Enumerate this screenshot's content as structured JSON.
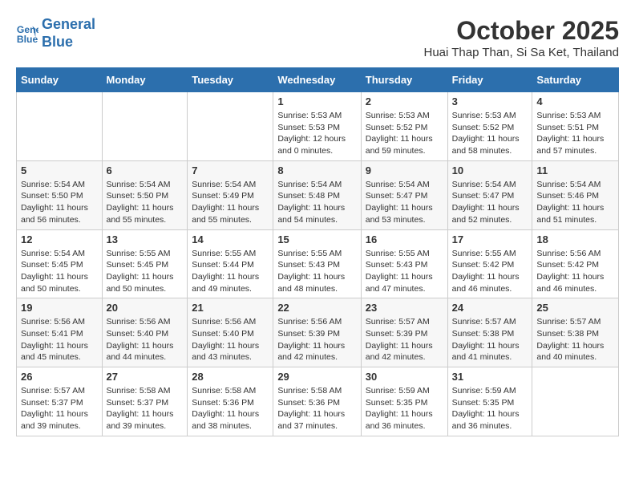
{
  "header": {
    "logo_line1": "General",
    "logo_line2": "Blue",
    "month": "October 2025",
    "location": "Huai Thap Than, Si Sa Ket, Thailand"
  },
  "weekdays": [
    "Sunday",
    "Monday",
    "Tuesday",
    "Wednesday",
    "Thursday",
    "Friday",
    "Saturday"
  ],
  "weeks": [
    [
      {
        "day": "",
        "sunrise": "",
        "sunset": "",
        "daylight": ""
      },
      {
        "day": "",
        "sunrise": "",
        "sunset": "",
        "daylight": ""
      },
      {
        "day": "",
        "sunrise": "",
        "sunset": "",
        "daylight": ""
      },
      {
        "day": "1",
        "sunrise": "Sunrise: 5:53 AM",
        "sunset": "Sunset: 5:53 PM",
        "daylight": "Daylight: 12 hours and 0 minutes."
      },
      {
        "day": "2",
        "sunrise": "Sunrise: 5:53 AM",
        "sunset": "Sunset: 5:52 PM",
        "daylight": "Daylight: 11 hours and 59 minutes."
      },
      {
        "day": "3",
        "sunrise": "Sunrise: 5:53 AM",
        "sunset": "Sunset: 5:52 PM",
        "daylight": "Daylight: 11 hours and 58 minutes."
      },
      {
        "day": "4",
        "sunrise": "Sunrise: 5:53 AM",
        "sunset": "Sunset: 5:51 PM",
        "daylight": "Daylight: 11 hours and 57 minutes."
      }
    ],
    [
      {
        "day": "5",
        "sunrise": "Sunrise: 5:54 AM",
        "sunset": "Sunset: 5:50 PM",
        "daylight": "Daylight: 11 hours and 56 minutes."
      },
      {
        "day": "6",
        "sunrise": "Sunrise: 5:54 AM",
        "sunset": "Sunset: 5:50 PM",
        "daylight": "Daylight: 11 hours and 55 minutes."
      },
      {
        "day": "7",
        "sunrise": "Sunrise: 5:54 AM",
        "sunset": "Sunset: 5:49 PM",
        "daylight": "Daylight: 11 hours and 55 minutes."
      },
      {
        "day": "8",
        "sunrise": "Sunrise: 5:54 AM",
        "sunset": "Sunset: 5:48 PM",
        "daylight": "Daylight: 11 hours and 54 minutes."
      },
      {
        "day": "9",
        "sunrise": "Sunrise: 5:54 AM",
        "sunset": "Sunset: 5:47 PM",
        "daylight": "Daylight: 11 hours and 53 minutes."
      },
      {
        "day": "10",
        "sunrise": "Sunrise: 5:54 AM",
        "sunset": "Sunset: 5:47 PM",
        "daylight": "Daylight: 11 hours and 52 minutes."
      },
      {
        "day": "11",
        "sunrise": "Sunrise: 5:54 AM",
        "sunset": "Sunset: 5:46 PM",
        "daylight": "Daylight: 11 hours and 51 minutes."
      }
    ],
    [
      {
        "day": "12",
        "sunrise": "Sunrise: 5:54 AM",
        "sunset": "Sunset: 5:45 PM",
        "daylight": "Daylight: 11 hours and 50 minutes."
      },
      {
        "day": "13",
        "sunrise": "Sunrise: 5:55 AM",
        "sunset": "Sunset: 5:45 PM",
        "daylight": "Daylight: 11 hours and 50 minutes."
      },
      {
        "day": "14",
        "sunrise": "Sunrise: 5:55 AM",
        "sunset": "Sunset: 5:44 PM",
        "daylight": "Daylight: 11 hours and 49 minutes."
      },
      {
        "day": "15",
        "sunrise": "Sunrise: 5:55 AM",
        "sunset": "Sunset: 5:43 PM",
        "daylight": "Daylight: 11 hours and 48 minutes."
      },
      {
        "day": "16",
        "sunrise": "Sunrise: 5:55 AM",
        "sunset": "Sunset: 5:43 PM",
        "daylight": "Daylight: 11 hours and 47 minutes."
      },
      {
        "day": "17",
        "sunrise": "Sunrise: 5:55 AM",
        "sunset": "Sunset: 5:42 PM",
        "daylight": "Daylight: 11 hours and 46 minutes."
      },
      {
        "day": "18",
        "sunrise": "Sunrise: 5:56 AM",
        "sunset": "Sunset: 5:42 PM",
        "daylight": "Daylight: 11 hours and 46 minutes."
      }
    ],
    [
      {
        "day": "19",
        "sunrise": "Sunrise: 5:56 AM",
        "sunset": "Sunset: 5:41 PM",
        "daylight": "Daylight: 11 hours and 45 minutes."
      },
      {
        "day": "20",
        "sunrise": "Sunrise: 5:56 AM",
        "sunset": "Sunset: 5:40 PM",
        "daylight": "Daylight: 11 hours and 44 minutes."
      },
      {
        "day": "21",
        "sunrise": "Sunrise: 5:56 AM",
        "sunset": "Sunset: 5:40 PM",
        "daylight": "Daylight: 11 hours and 43 minutes."
      },
      {
        "day": "22",
        "sunrise": "Sunrise: 5:56 AM",
        "sunset": "Sunset: 5:39 PM",
        "daylight": "Daylight: 11 hours and 42 minutes."
      },
      {
        "day": "23",
        "sunrise": "Sunrise: 5:57 AM",
        "sunset": "Sunset: 5:39 PM",
        "daylight": "Daylight: 11 hours and 42 minutes."
      },
      {
        "day": "24",
        "sunrise": "Sunrise: 5:57 AM",
        "sunset": "Sunset: 5:38 PM",
        "daylight": "Daylight: 11 hours and 41 minutes."
      },
      {
        "day": "25",
        "sunrise": "Sunrise: 5:57 AM",
        "sunset": "Sunset: 5:38 PM",
        "daylight": "Daylight: 11 hours and 40 minutes."
      }
    ],
    [
      {
        "day": "26",
        "sunrise": "Sunrise: 5:57 AM",
        "sunset": "Sunset: 5:37 PM",
        "daylight": "Daylight: 11 hours and 39 minutes."
      },
      {
        "day": "27",
        "sunrise": "Sunrise: 5:58 AM",
        "sunset": "Sunset: 5:37 PM",
        "daylight": "Daylight: 11 hours and 39 minutes."
      },
      {
        "day": "28",
        "sunrise": "Sunrise: 5:58 AM",
        "sunset": "Sunset: 5:36 PM",
        "daylight": "Daylight: 11 hours and 38 minutes."
      },
      {
        "day": "29",
        "sunrise": "Sunrise: 5:58 AM",
        "sunset": "Sunset: 5:36 PM",
        "daylight": "Daylight: 11 hours and 37 minutes."
      },
      {
        "day": "30",
        "sunrise": "Sunrise: 5:59 AM",
        "sunset": "Sunset: 5:35 PM",
        "daylight": "Daylight: 11 hours and 36 minutes."
      },
      {
        "day": "31",
        "sunrise": "Sunrise: 5:59 AM",
        "sunset": "Sunset: 5:35 PM",
        "daylight": "Daylight: 11 hours and 36 minutes."
      },
      {
        "day": "",
        "sunrise": "",
        "sunset": "",
        "daylight": ""
      }
    ]
  ]
}
